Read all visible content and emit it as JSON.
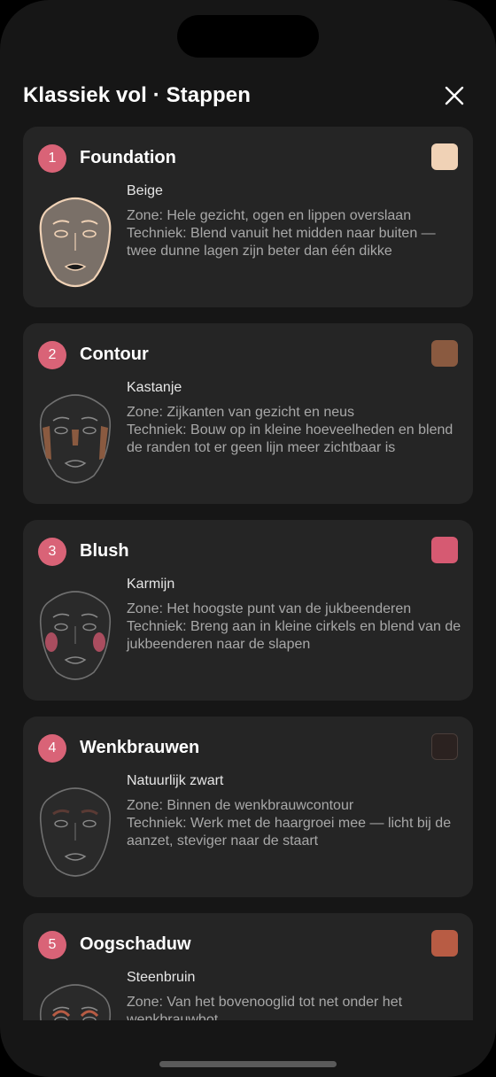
{
  "header": {
    "title": "Klassiek vol · Stappen"
  },
  "steps": [
    {
      "number": "1",
      "name": "Foundation",
      "swatch": "#f0d2b6",
      "shade": "Beige",
      "zone": "Zone: Hele gezicht, ogen en lippen overslaan",
      "technique": "Techniek: Blend vanuit het midden naar buiten — twee dunne lagen zijn beter dan één dikke",
      "face_icon": "foundation-face-icon"
    },
    {
      "number": "2",
      "name": "Contour",
      "swatch": "#8a5a40",
      "shade": "Kastanje",
      "zone": "Zone: Zijkanten van gezicht en neus",
      "technique": "Techniek: Bouw op in kleine hoeveelheden en blend de randen tot er geen lijn meer zichtbaar is",
      "face_icon": "contour-face-icon"
    },
    {
      "number": "3",
      "name": "Blush",
      "swatch": "#d65a72",
      "shade": "Karmijn",
      "zone": "Zone: Het hoogste punt van de jukbeenderen",
      "technique": "Techniek: Breng aan in kleine cirkels en blend van de jukbeenderen naar de slapen",
      "face_icon": "blush-face-icon"
    },
    {
      "number": "4",
      "name": "Wenkbrauwen",
      "swatch": "#2b2220",
      "shade": "Natuurlijk zwart",
      "zone": "Zone: Binnen de wenkbrauwcontour",
      "technique": "Techniek: Werk met de haargroei mee — licht bij de aanzet, steviger naar de staart",
      "face_icon": "eyebrow-face-icon"
    },
    {
      "number": "5",
      "name": "Oogschaduw",
      "swatch": "#b85c44",
      "shade": "Steenbruin",
      "zone": "Zone: Van het bovenooglid tot net onder het wenkbrauwbot",
      "technique": "",
      "face_icon": "eyeshadow-face-icon"
    }
  ],
  "colors": {
    "background": "#161616",
    "card": "#252525",
    "accent": "#d96377"
  },
  "icons": {
    "close": "close-icon"
  }
}
